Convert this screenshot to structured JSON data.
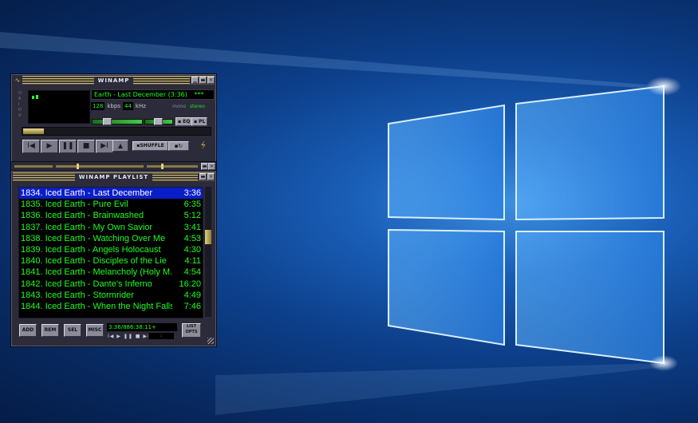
{
  "colors": {
    "lcd_green": "#1fff1f",
    "selected_row": "#0a1ec8",
    "desktop_blue": "#1a5fb8"
  },
  "main": {
    "title": "WINAMP",
    "song": "Earth - Last December (3:36)",
    "song_scroll": "***",
    "kbps": "128",
    "kbps_label": "kbps",
    "khz": "44",
    "khz_label": "kHz",
    "mono": "mono",
    "stereo": "stereo",
    "eq_label": "EQ",
    "pl_label": "PL",
    "shuffle_label": "SHUFFLE",
    "repeat_icon": "repeat-icon",
    "volume": 0.6,
    "balance": 0.5,
    "seek": 0.0
  },
  "playlist": {
    "title": "WINAMP PLAYLIST",
    "items": [
      {
        "title": "1834. Iced Earth - Last December",
        "time": "3:36",
        "selected": true
      },
      {
        "title": "1835. Iced Earth - Pure Evil",
        "time": "6:35"
      },
      {
        "title": "1836. Iced Earth - Brainwashed",
        "time": "5:12"
      },
      {
        "title": "1837. Iced Earth - My Own Savior",
        "time": "3:41"
      },
      {
        "title": "1838. Iced Earth - Watching Over Me",
        "time": "4:53"
      },
      {
        "title": "1839. Iced Earth - Angels Holocaust",
        "time": "4:30"
      },
      {
        "title": "1840. Iced Earth - Disciples of the Lie",
        "time": "4:11"
      },
      {
        "title": "1841. Iced Earth - Melancholy (Holy M...",
        "time": "4:54"
      },
      {
        "title": "1842. Iced Earth - Dante's Inferno",
        "time": "16:20"
      },
      {
        "title": "1843. Iced Earth - Stormrider",
        "time": "4:49"
      },
      {
        "title": "1844. Iced Earth - When the Night Falls",
        "time": "7:46"
      }
    ],
    "buttons": {
      "add": "ADD",
      "rem": "REM",
      "sel": "SEL",
      "misc": "MISC"
    },
    "info": "3:36/886:38:11+",
    "list_opts_1": "LIST",
    "list_opts_2": "OPTS",
    "mini_controls": "I◀ ▶ ❚❚ ■ ▶I ▲",
    "mini_time": ":"
  }
}
